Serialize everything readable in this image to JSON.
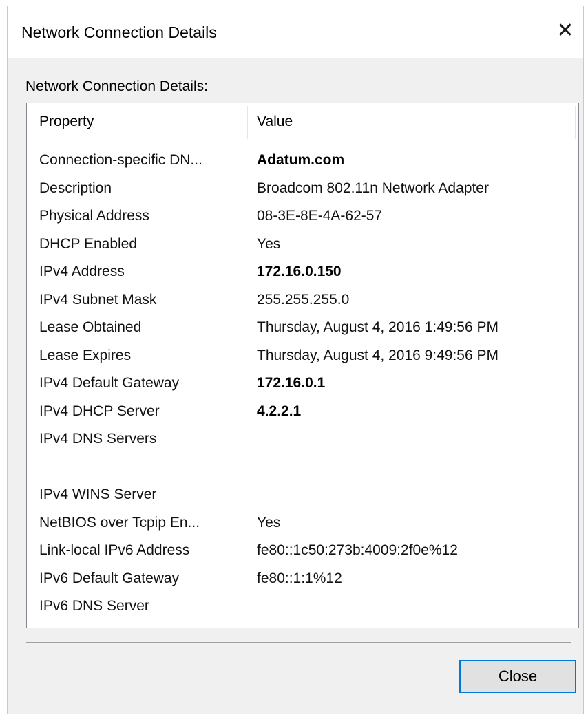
{
  "window": {
    "title": "Network Connection Details",
    "close_glyph": "✕"
  },
  "group_label": "Network Connection Details:",
  "list": {
    "columns": [
      "Property",
      "Value"
    ],
    "rows": [
      {
        "property": "Connection-specific DN...",
        "value": "Adatum.com",
        "bold": true
      },
      {
        "property": "Description",
        "value": "Broadcom 802.11n Network Adapter",
        "bold": false
      },
      {
        "property": "Physical Address",
        "value": "08-3E-8E-4A-62-57",
        "bold": false
      },
      {
        "property": "DHCP Enabled",
        "value": "Yes",
        "bold": false
      },
      {
        "property": "IPv4 Address",
        "value": "172.16.0.150",
        "bold": true
      },
      {
        "property": "IPv4 Subnet Mask",
        "value": "255.255.255.0",
        "bold": false
      },
      {
        "property": "Lease Obtained",
        "value": "Thursday, August 4, 2016 1:49:56 PM",
        "bold": false
      },
      {
        "property": "Lease Expires",
        "value": "Thursday, August 4, 2016 9:49:56 PM",
        "bold": false
      },
      {
        "property": "IPv4 Default Gateway",
        "value": "172.16.0.1",
        "bold": true
      },
      {
        "property": "IPv4 DHCP Server",
        "value": "4.2.2.1",
        "bold": true
      },
      {
        "property": "IPv4 DNS Servers",
        "value": "",
        "bold": false
      },
      {
        "property": "",
        "value": "",
        "bold": false
      },
      {
        "property": "IPv4 WINS Server",
        "value": "",
        "bold": false
      },
      {
        "property": "NetBIOS over Tcpip En...",
        "value": "Yes",
        "bold": false
      },
      {
        "property": "Link-local IPv6 Address",
        "value": "fe80::1c50:273b:4009:2f0e%12",
        "bold": false
      },
      {
        "property": "IPv6 Default Gateway",
        "value": "fe80::1:1%12",
        "bold": false
      },
      {
        "property": "IPv6 DNS Server",
        "value": "",
        "bold": false
      }
    ]
  },
  "buttons": {
    "close_label": "Close"
  },
  "colors": {
    "dialog_bg": "#f0f0f0",
    "list_bg": "#ffffff",
    "button_focus_border": "#0078d7"
  },
  "icons": {
    "close": "close-icon"
  }
}
